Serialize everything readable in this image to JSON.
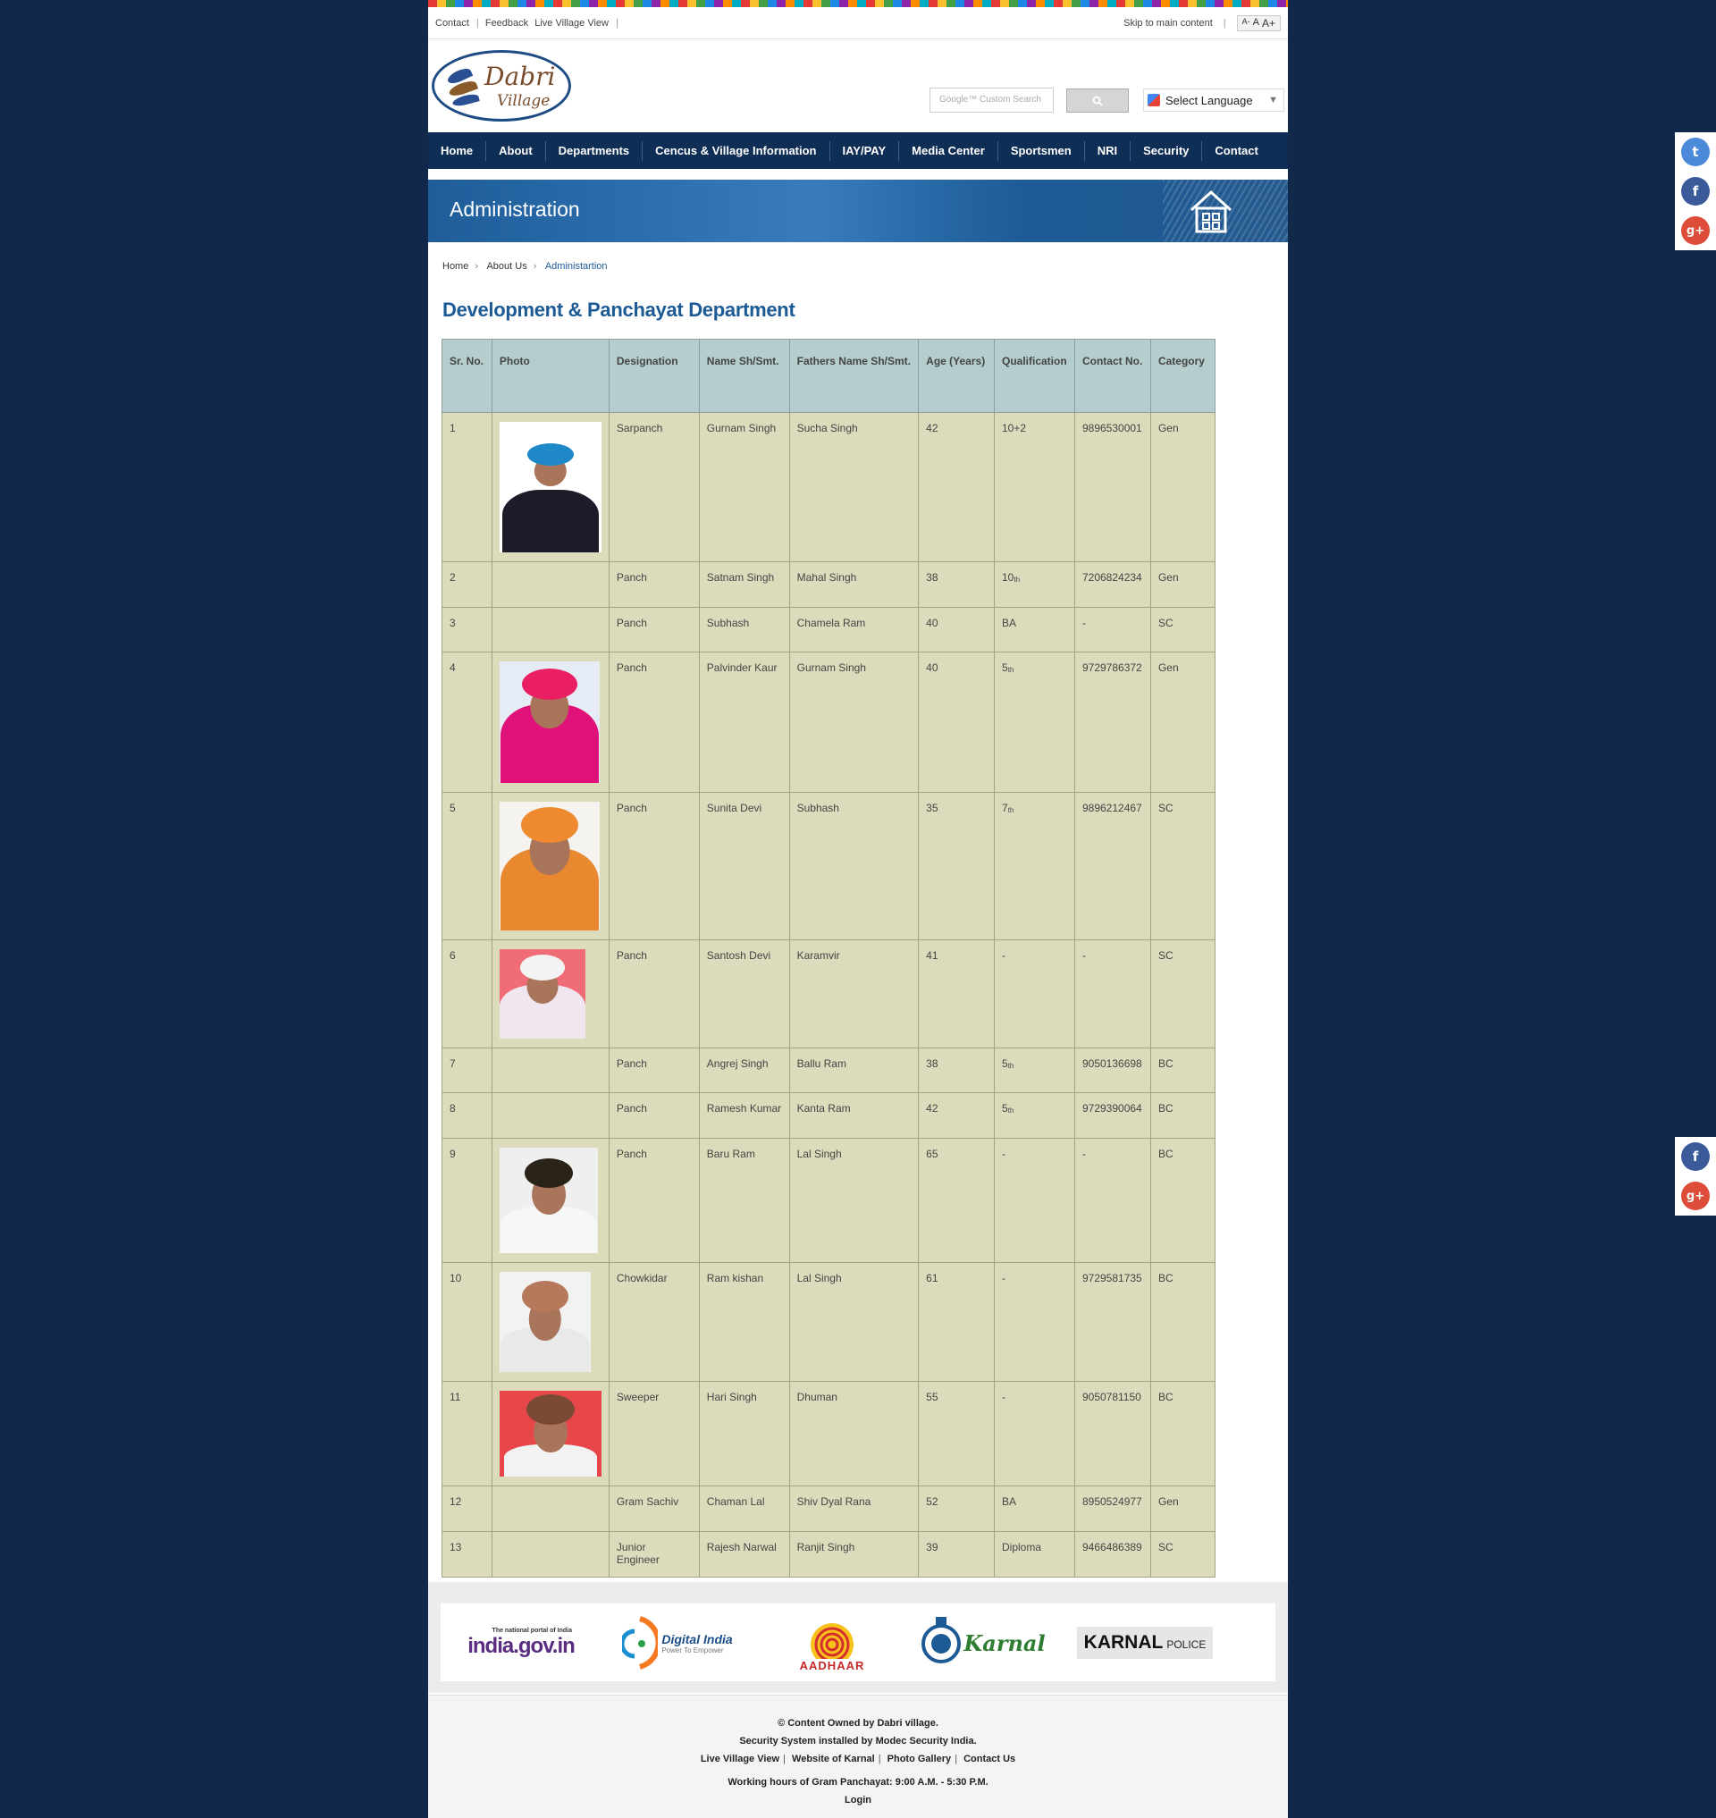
{
  "topbar": {
    "links": [
      "Contact",
      "Feedback",
      "Live Village View"
    ],
    "skip": "Skip to main content",
    "font_small": "A-",
    "font_normal": "A",
    "font_large": "A+"
  },
  "header": {
    "logo_line1": "Dabri",
    "logo_line2": "Village",
    "search_placeholder": "Google™ Custom Search",
    "language_label": "Select Language"
  },
  "nav": {
    "items": [
      "Home",
      "About",
      "Departments",
      "Cencus & Village Information",
      "IAY/PAY",
      "Media Center",
      "Sportsmen",
      "NRI",
      "Security",
      "Contact"
    ]
  },
  "banner": {
    "title": "Administration"
  },
  "breadcrumb": {
    "home": "Home",
    "about": "About Us",
    "current": "Administartion"
  },
  "heading": "Development & Panchayat Department",
  "table": {
    "headers": [
      "Sr. No.",
      "Photo",
      "Designation",
      "Name Sh/Smt.",
      "Fathers Name Sh/Smt.",
      "Age (Years)",
      "Qualification",
      "Contact No.",
      "Category"
    ],
    "rows": [
      {
        "sr": "1",
        "designation": "Sarpanch",
        "name": "Gurnam Singh",
        "father": "Sucha Singh",
        "age": "42",
        "qual": "10+2",
        "qual_sup": "",
        "contact": "9896530001",
        "category": "Gen"
      },
      {
        "sr": "2",
        "designation": "Panch",
        "name": "Satnam Singh",
        "father": "Mahal Singh",
        "age": "38",
        "qual": "10",
        "qual_sup": "th",
        "contact": "7206824234",
        "category": "Gen"
      },
      {
        "sr": "3",
        "designation": "Panch",
        "name": "Subhash",
        "father": "Chamela Ram",
        "age": "40",
        "qual": "BA",
        "qual_sup": "",
        "contact": "-",
        "category": "SC"
      },
      {
        "sr": "4",
        "designation": "Panch",
        "name": "Palvinder Kaur",
        "father": "Gurnam Singh",
        "age": "40",
        "qual": "5",
        "qual_sup": "th",
        "contact": "9729786372",
        "category": "Gen"
      },
      {
        "sr": "5",
        "designation": "Panch",
        "name": "Sunita Devi",
        "father": "Subhash",
        "age": "35",
        "qual": "7",
        "qual_sup": "th",
        "contact": "9896212467",
        "category": "SC"
      },
      {
        "sr": "6",
        "designation": "Panch",
        "name": "Santosh Devi",
        "father": "Karamvir",
        "age": "41",
        "qual": "-",
        "qual_sup": "",
        "contact": "-",
        "category": "SC"
      },
      {
        "sr": "7",
        "designation": "Panch",
        "name": "Angrej Singh",
        "father": "Ballu Ram",
        "age": "38",
        "qual": "5",
        "qual_sup": "th",
        "contact": "9050136698",
        "category": "BC"
      },
      {
        "sr": "8",
        "designation": "Panch",
        "name": "Ramesh Kumar",
        "father": "Kanta Ram",
        "age": "42",
        "qual": "5",
        "qual_sup": "th",
        "contact": "9729390064",
        "category": "BC"
      },
      {
        "sr": "9",
        "designation": "Panch",
        "name": "Baru Ram",
        "father": "Lal Singh",
        "age": "65",
        "qual": "-",
        "qual_sup": "",
        "contact": "-",
        "category": "BC"
      },
      {
        "sr": "10",
        "designation": "Chowkidar",
        "name": "Ram kishan",
        "father": "Lal Singh",
        "age": "61",
        "qual": "-",
        "qual_sup": "",
        "contact": "9729581735",
        "category": "BC"
      },
      {
        "sr": "11",
        "designation": "Sweeper",
        "name": "Hari Singh",
        "father": "Dhuman",
        "age": "55",
        "qual": "-",
        "qual_sup": "",
        "contact": "9050781150",
        "category": "BC"
      },
      {
        "sr": "12",
        "designation": "Gram Sachiv",
        "name": "Chaman Lal",
        "father": "Shiv Dyal Rana",
        "age": "52",
        "qual": "BA",
        "qual_sup": "",
        "contact": "8950524977",
        "category": "Gen"
      },
      {
        "sr": "13",
        "designation": "Junior Engineer",
        "name": "Rajesh Narwal",
        "father": "Ranjit Singh",
        "age": "39",
        "qual": "Diploma",
        "qual_sup": "",
        "contact": "9466486389",
        "category": "SC"
      }
    ]
  },
  "footer_logos": {
    "india_gov": "india.gov.in",
    "india_gov_tag": "The national portal of India",
    "digital_india": "Digital India",
    "digital_india_tag": "Power To Empower",
    "aadhaar": "AADHAAR",
    "karnal": "Karnal",
    "karnal_police": "KARNAL",
    "karnal_police_sub": "POLICE"
  },
  "footer": {
    "owned": "© Content Owned by Dabri village.",
    "security": "Security System installed by Modec Security India.",
    "links": [
      "Live Village View",
      "Website of Karnal",
      "Photo Gallery",
      "Contact Us"
    ],
    "hours": "Working hours of Gram Panchayat: 9:00 A.M. - 5:30 P.M.",
    "login": "Login"
  },
  "colors": {
    "background": "#11284a",
    "nav": "#0f2e55",
    "heading": "#1c5a96",
    "table_header": "#b6cdcd",
    "table_cell": "#dcdcbd"
  }
}
